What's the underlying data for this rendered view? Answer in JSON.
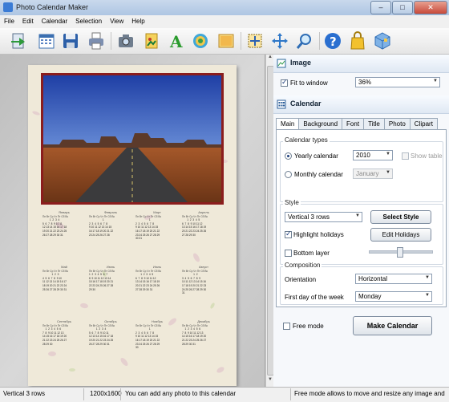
{
  "window": {
    "title": "Photo Calendar Maker",
    "controls": [
      "–",
      "□",
      "✕"
    ]
  },
  "menu": [
    "File",
    "Edit",
    "Calendar",
    "Selection",
    "View",
    "Help"
  ],
  "toolbar": {
    "icons": [
      "open-icon",
      "calendar-icon",
      "save-icon",
      "print-icon",
      "camera-icon",
      "clipart-icon",
      "text-icon",
      "background-icon",
      "image-icon",
      "select-all-icon",
      "move-icon",
      "zoom-icon",
      "help-icon",
      "bag-icon",
      "box-icon"
    ]
  },
  "calendar_preview": {
    "weekday_header": "Пн Вт Ср Чт Пт Сб Вс",
    "months": [
      {
        "name": "Январь",
        "rows": [
          "",
          "          1  2  3  4",
          "5  6  7  8  9 10 11",
          "12 13 14 15 16 17 18",
          "19 20 21 22 23 24 25",
          "26 27 28 29 30 31"
        ]
      },
      {
        "name": "Февраль",
        "rows": [
          "",
          "                   1",
          "2  3  4  5  6  7  8",
          "9 10 11 12 13 14 15",
          "16 17 18 19 20 21 22",
          "23 24 25 26 27 28"
        ]
      },
      {
        "name": "Март",
        "rows": [
          "",
          "                   1",
          "2  3  4  5  6  7  8",
          "9 10 11 12 13 14 15",
          "16 17 18 19 20 21 22",
          "23 24 25 26 27 28 29",
          "30 31"
        ]
      },
      {
        "name": "Апрель",
        "rows": [
          "",
          "       1  2  3  4  5",
          "6  7  8  9 10 11 12",
          "13 14 15 16 17 18 19",
          "20 21 22 23 24 25 26",
          "27 28 29 30"
        ]
      },
      {
        "name": "Май",
        "rows": [
          "",
          "             1  2  3",
          "4  5  6  7  8  9 10",
          "11 12 13 14 15 16 17",
          "18 19 20 21 22 23 24",
          "25 26 27 28 29 30 31"
        ]
      },
      {
        "name": "Июнь",
        "rows": [
          "",
          "1  2  3  4  5  6  7",
          "8  9 10 11 12 13 14",
          "15 16 17 18 19 20 21",
          "22 23 24 25 26 27 28",
          "29 30"
        ]
      },
      {
        "name": "Июль",
        "rows": [
          "",
          "       1  2  3  4  5",
          "6  7  8  9 10 11 12",
          "13 14 15 16 17 18 19",
          "20 21 22 23 24 25 26",
          "27 28 29 30 31"
        ]
      },
      {
        "name": "Август",
        "rows": [
          "",
          "                1  2",
          "3  4  5  6  7  8  9",
          "10 11 12 13 14 15 16",
          "17 18 19 20 21 22 23",
          "24 25 26 27 28 29 30",
          "31"
        ]
      },
      {
        "name": "Сентябрь",
        "rows": [
          "",
          "    1  2  3  4  5  6",
          "7  8  9 10 11 12 13",
          "14 15 16 17 18 19 20",
          "21 22 23 24 25 26 27",
          "28 29 30"
        ]
      },
      {
        "name": "Октябрь",
        "rows": [
          "",
          "          1  2  3  4",
          "5  6  7  8  9 10 11",
          "12 13 14 15 16 17 18",
          "19 20 21 22 23 24 25",
          "26 27 28 29 30 31"
        ]
      },
      {
        "name": "Ноябрь",
        "rows": [
          "",
          "                   1",
          "2  3  4  5  6  7  8",
          "9 10 11 12 13 14 15",
          "16 17 18 19 20 21 22",
          "23 24 25 26 27 28 29",
          "30"
        ]
      },
      {
        "name": "Декабрь",
        "rows": [
          "",
          "    1  2  3  4  5  6",
          "7  8  9 10 11 12 13",
          "14 15 16 17 18 19 20",
          "21 22 23 24 25 26 27",
          "28 29 30 31"
        ]
      }
    ]
  },
  "image_section": {
    "title": "Image",
    "fit_to_window": {
      "label": "Fit to window",
      "checked": true
    },
    "zoom": "36%"
  },
  "calendar_section": {
    "title": "Calendar",
    "tabs": [
      "Main",
      "Background",
      "Font",
      "Title",
      "Photo",
      "Clipart"
    ],
    "active_tab": "Main",
    "calendar_types": {
      "title": "Calendar types",
      "yearly": "Yearly calendar",
      "monthly": "Monthly calendar",
      "year": "2010",
      "month": "January",
      "show_table": "Show table"
    },
    "style": {
      "title": "Style",
      "layout": "Vertical 3 rows",
      "select_style": "Select Style",
      "highlight_holidays": "Highlight holidays",
      "edit_holidays": "Edit Holidays",
      "bottom_layer": "Bottom layer"
    },
    "composition": {
      "title": "Composition",
      "orientation_label": "Orientation",
      "orientation": "Horizontal",
      "first_day_label": "First day of the week",
      "first_day": "Monday"
    }
  },
  "free_mode": "Free mode",
  "make_calendar": "Make Calendar",
  "status": {
    "layout": "Vertical 3 rows",
    "size": "1200x1600",
    "hint1": "You can add any photo to this calendar",
    "hint2": "Free mode allows to move and resize any image and te"
  }
}
